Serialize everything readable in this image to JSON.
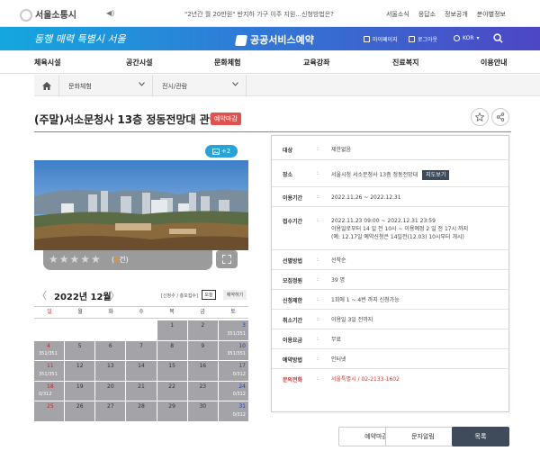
{
  "header": {
    "logo_text": "서울소통시",
    "speaker": "◀)",
    "notice": "\"2년간 월 20만원\" 반지하 가구 이주 지원...신청방법은?",
    "links": [
      "서울소식",
      "응답소",
      "정보공개",
      "분야별정보"
    ]
  },
  "banner": {
    "slogan": "동행 매력 특별시 서울",
    "service_title": "공공서비스예약",
    "nav": [
      "마이페이지",
      "로그아웃",
      "KOR"
    ]
  },
  "menu": [
    "체육시설",
    "공간시설",
    "문화체험",
    "교육강좌",
    "진료복지",
    "이용안내"
  ],
  "breadcrumb": {
    "level1": "문화체험",
    "level2": "전시/관람"
  },
  "page": {
    "title": "(주말)서소문청사 13층 정동전망대 관람",
    "status_badge": "예약마감"
  },
  "gallery": {
    "more_count": "+2",
    "rating_stars": "★★★★★",
    "rating_open": "(",
    "rating_count": "0",
    "rating_close": "건)"
  },
  "calendar": {
    "prev": "〈",
    "title": "2022년 12월",
    "next": "〉",
    "legend": "[신청수 / 총모집수]",
    "today_label": "오늘",
    "reserve_label": "예약하기",
    "weekdays": [
      "일",
      "월",
      "화",
      "수",
      "목",
      "금",
      "토"
    ],
    "cells": [
      {
        "d": "",
        "v": ""
      },
      {
        "d": "",
        "v": ""
      },
      {
        "d": "",
        "v": ""
      },
      {
        "d": "",
        "v": ""
      },
      {
        "d": "1",
        "v": ""
      },
      {
        "d": "2",
        "v": ""
      },
      {
        "d": "3",
        "v": "351/351"
      },
      {
        "d": "4",
        "v": "351/351"
      },
      {
        "d": "5",
        "v": ""
      },
      {
        "d": "6",
        "v": ""
      },
      {
        "d": "7",
        "v": ""
      },
      {
        "d": "8",
        "v": ""
      },
      {
        "d": "9",
        "v": ""
      },
      {
        "d": "10",
        "v": "351/351"
      },
      {
        "d": "11",
        "v": "351/351"
      },
      {
        "d": "12",
        "v": ""
      },
      {
        "d": "13",
        "v": ""
      },
      {
        "d": "14",
        "v": ""
      },
      {
        "d": "15",
        "v": ""
      },
      {
        "d": "16",
        "v": ""
      },
      {
        "d": "17",
        "v": "0/312"
      },
      {
        "d": "18",
        "v": "0/312"
      },
      {
        "d": "19",
        "v": ""
      },
      {
        "d": "20",
        "v": ""
      },
      {
        "d": "21",
        "v": ""
      },
      {
        "d": "22",
        "v": ""
      },
      {
        "d": "23",
        "v": ""
      },
      {
        "d": "24",
        "v": "0/312"
      },
      {
        "d": "25",
        "v": ""
      },
      {
        "d": "26",
        "v": ""
      },
      {
        "d": "27",
        "v": ""
      },
      {
        "d": "28",
        "v": ""
      },
      {
        "d": "29",
        "v": ""
      },
      {
        "d": "30",
        "v": ""
      },
      {
        "d": "31",
        "v": "0/312"
      }
    ]
  },
  "info": {
    "colon": ":",
    "rows": [
      {
        "label": "대상",
        "lines": [
          "제한없음"
        ]
      },
      {
        "label": "장소",
        "lines": [
          "서울시청 서소문청사 13층 정동전망대"
        ],
        "button": "지도보기"
      },
      {
        "label": "이용기간",
        "lines": [
          "2022.11.26 ~ 2022.12.31"
        ]
      },
      {
        "label": "접수기간",
        "lines": [
          "2022.11.23 09:00 ~ 2022.12.31 23:59",
          "이용일로부터 14 일 전 10시 ~ 이용예정 2 일 전 17시 까지",
          "(예: 12.17일 예약신청은 14일전(12.03) 10시부터 개시)"
        ]
      },
      {
        "label": "선별방법",
        "lines": [
          "선착순"
        ]
      },
      {
        "label": "모집정원",
        "lines": [
          "39 명"
        ]
      },
      {
        "label": "신청제한",
        "lines": [
          "1회에 1 ~ 4번 까지 신청가능"
        ]
      },
      {
        "label": "취소기간",
        "lines": [
          "이용일 3일 전까지"
        ]
      },
      {
        "label": "이용요금",
        "lines": [
          "무료"
        ]
      },
      {
        "label": "예약방법",
        "lines": [
          "인터넷"
        ]
      },
      {
        "label": "문의전화",
        "lines": [
          "서울특별시 / 02-2133-1602"
        ]
      }
    ]
  },
  "buttons": {
    "closed": "예약마감",
    "sms": "문자알림",
    "list": "목록"
  },
  "colors": {
    "banner_start": "#14a7df",
    "banner_end": "#4d46c5",
    "badge_red": "#e0524f",
    "dark_button": "#3f4b5a"
  }
}
